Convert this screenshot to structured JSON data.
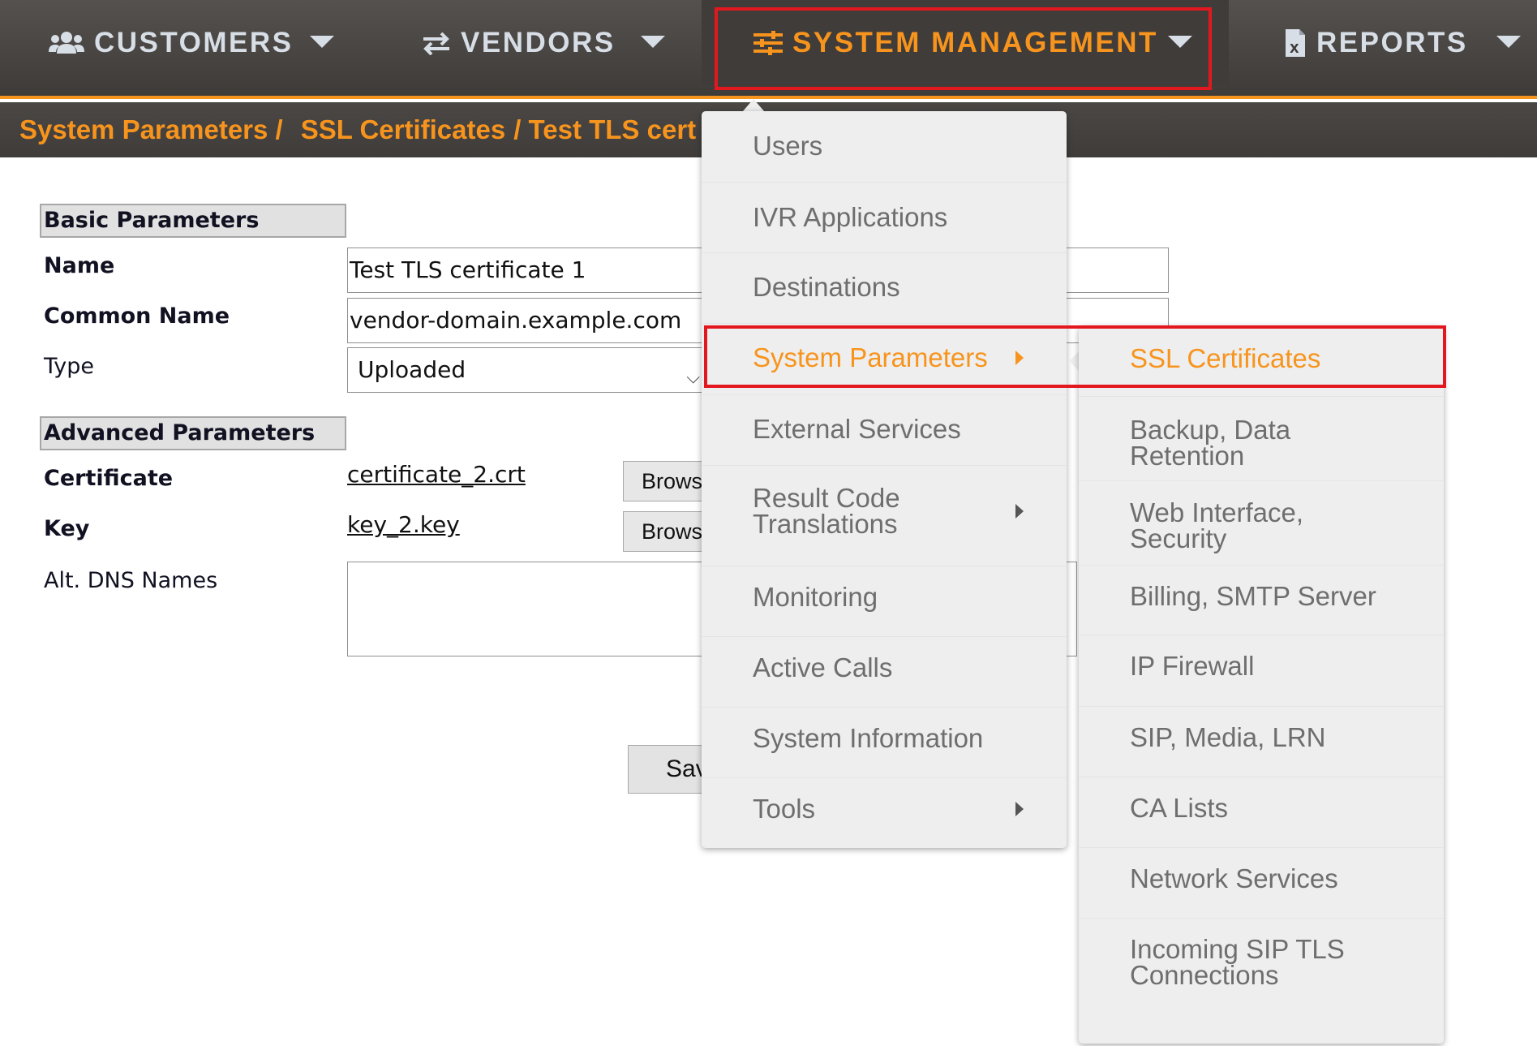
{
  "nav": {
    "items": [
      {
        "label": "CUSTOMERS",
        "icon": "users-icon"
      },
      {
        "label": "VENDORS",
        "icon": "exchange-arrows-icon"
      },
      {
        "label": "SYSTEM MANAGEMENT",
        "icon": "sliders-icon"
      },
      {
        "label": "REPORTS",
        "icon": "excel-file-icon"
      }
    ],
    "active_color": "#f7941d"
  },
  "breadcrumb": {
    "items": [
      "System Parameters /",
      "SSL Certificates",
      "/ Test TLS cert"
    ]
  },
  "form": {
    "basic_header": "Basic Parameters",
    "name_label": "Name",
    "name_value": "Test TLS certificate 1",
    "common_name_label": "Common Name",
    "common_name_value": "vendor-domain.example.com",
    "type_label": "Type",
    "type_value": "Uploaded",
    "advanced_header": "Advanced Parameters",
    "certificate_label": "Certificate",
    "certificate_file": "certificate_2.crt",
    "key_label": "Key",
    "key_file": "key_2.key",
    "browse_label": "Brows",
    "alt_dns_label": "Alt. DNS Names",
    "save_label": "Sav"
  },
  "menu": {
    "main_items": [
      "Users",
      "IVR Applications",
      "Destinations",
      "System Parameters",
      "External Services",
      "Result Code Translations",
      "Monitoring",
      "Active Calls",
      "System Information",
      "Tools"
    ],
    "result_code_lines": [
      "Result Code",
      "Translations"
    ],
    "sub_items": [
      [
        "SSL Certificates"
      ],
      [
        "Backup, Data",
        "Retention"
      ],
      [
        "Web Interface,",
        "Security"
      ],
      [
        "Billing, SMTP Server"
      ],
      [
        "IP Firewall"
      ],
      [
        "SIP, Media, LRN"
      ],
      [
        "CA Lists"
      ],
      [
        "Network Services"
      ],
      [
        "Incoming SIP TLS",
        "Connections"
      ]
    ]
  },
  "colors": {
    "accent": "#f7941d",
    "highlight_box": "#e3181f",
    "nav_text": "#d7dee6",
    "menu_text": "#6e6e6e"
  }
}
